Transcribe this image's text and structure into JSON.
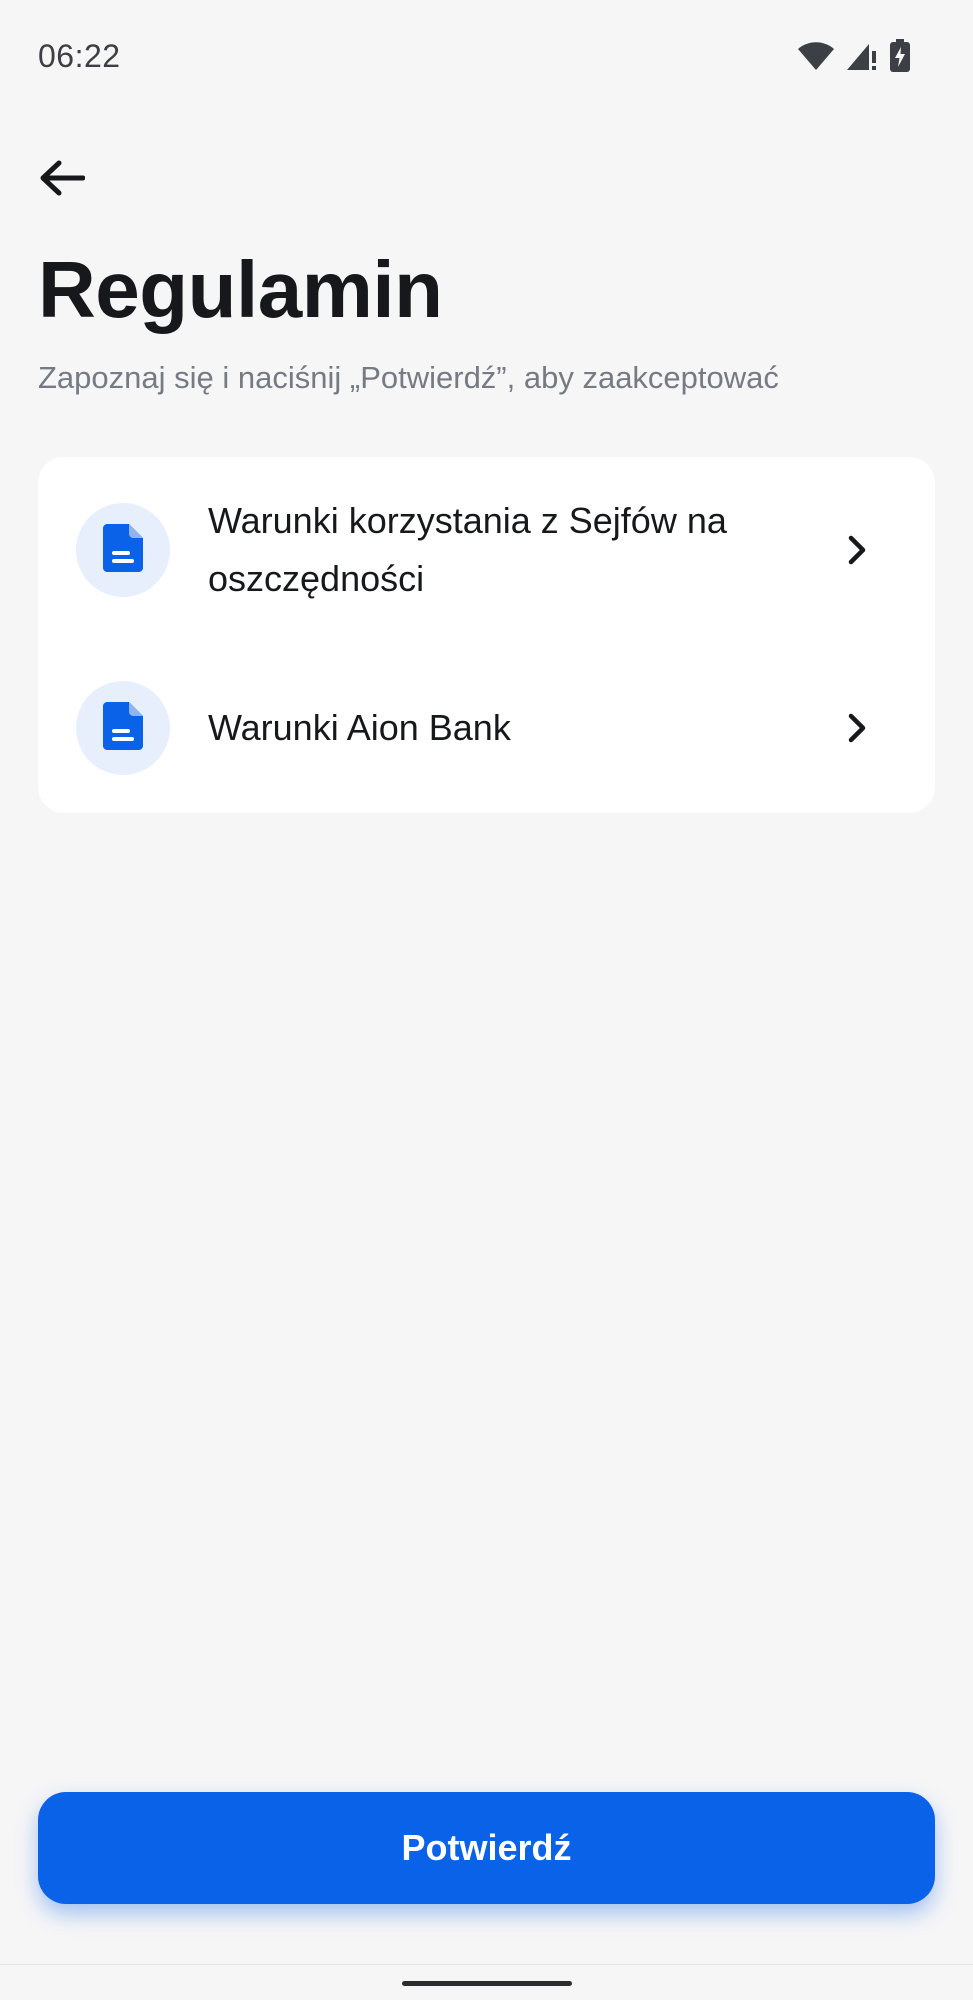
{
  "status_bar": {
    "time": "06:22",
    "icons": [
      "wifi-icon",
      "signal-icon",
      "battery-charging-icon"
    ]
  },
  "header": {
    "back_icon": "arrow-left-icon",
    "title": "Regulamin",
    "subtitle": "Zapoznaj się i naciśnij „Potwierdź”, aby zaakceptować"
  },
  "terms": {
    "items": [
      {
        "label": "Warunki korzystania z Sejfów na oszczędności",
        "icon": "document-icon"
      },
      {
        "label": "Warunki Aion Bank",
        "icon": "document-icon"
      }
    ]
  },
  "actions": {
    "confirm_label": "Potwierdź"
  },
  "colors": {
    "background": "#f6f6f7",
    "accent": "#0962e8",
    "icon_bg": "#e8effc",
    "subtitle": "#757a83"
  }
}
